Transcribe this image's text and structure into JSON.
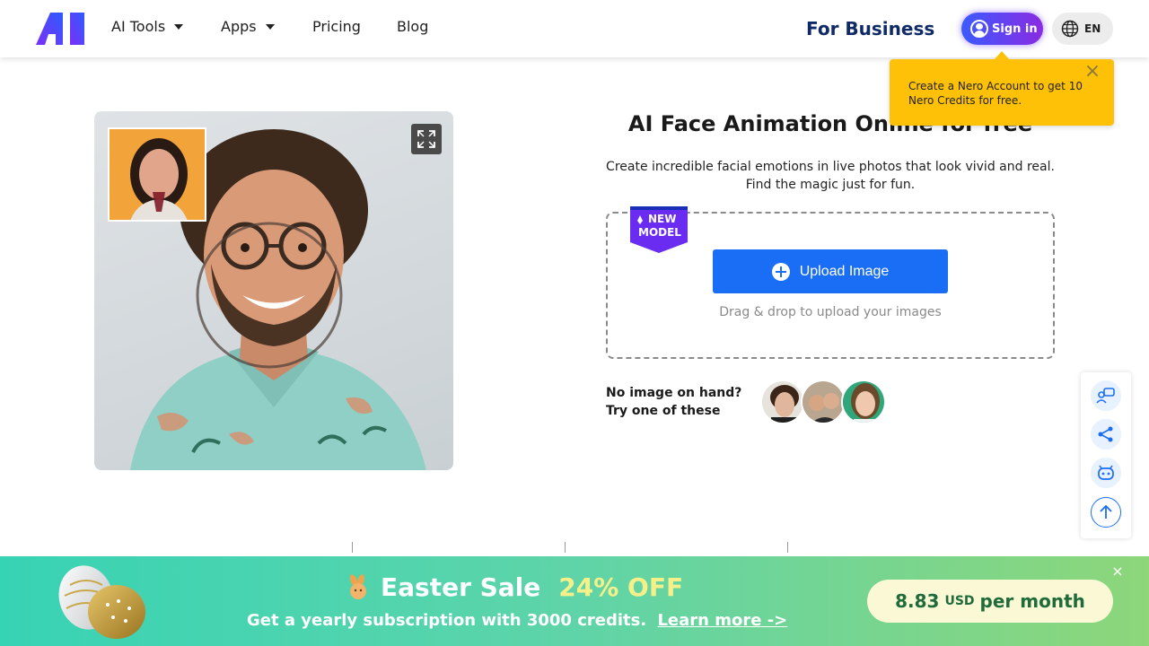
{
  "header": {
    "nav": [
      {
        "label": "AI Tools",
        "dropdown": true
      },
      {
        "label": "Apps",
        "dropdown": true
      },
      {
        "label": "Pricing",
        "dropdown": false
      },
      {
        "label": "Blog",
        "dropdown": false
      }
    ],
    "for_business": "For Business",
    "sign_in": "Sign in",
    "language": "EN"
  },
  "tooltip": {
    "text": "Create a Nero Account to get 10 Nero Credits for free."
  },
  "main": {
    "title": "AI Face Animation Online for free",
    "subtitle": "Create incredible facial emotions in live photos that look vivid and real. Find the magic just for fun.",
    "badge": {
      "line1": "NEW",
      "line2": "MODEL"
    },
    "upload_button": "Upload Image",
    "drag_hint": "Drag & drop to upload your images",
    "no_image_line1": "No image on hand?",
    "no_image_line2": "Try one of these"
  },
  "side_toolbar": {
    "icons": [
      "feedback-icon",
      "share-icon",
      "robot-icon",
      "arrow-up-icon"
    ]
  },
  "promo": {
    "title": "Easter Sale",
    "discount": "24% OFF",
    "subtitle": "Get a yearly subscription with 3000 credits.",
    "learn_more": "Learn more ->",
    "price": "8.83",
    "currency": "USD",
    "period": "per month",
    "close": "×"
  },
  "colors": {
    "primary": "#1a6ef5",
    "business_text": "#0f2a66",
    "tooltip": "#ffc107",
    "promo_start": "#37d3b5",
    "promo_end": "#8dd67a"
  }
}
